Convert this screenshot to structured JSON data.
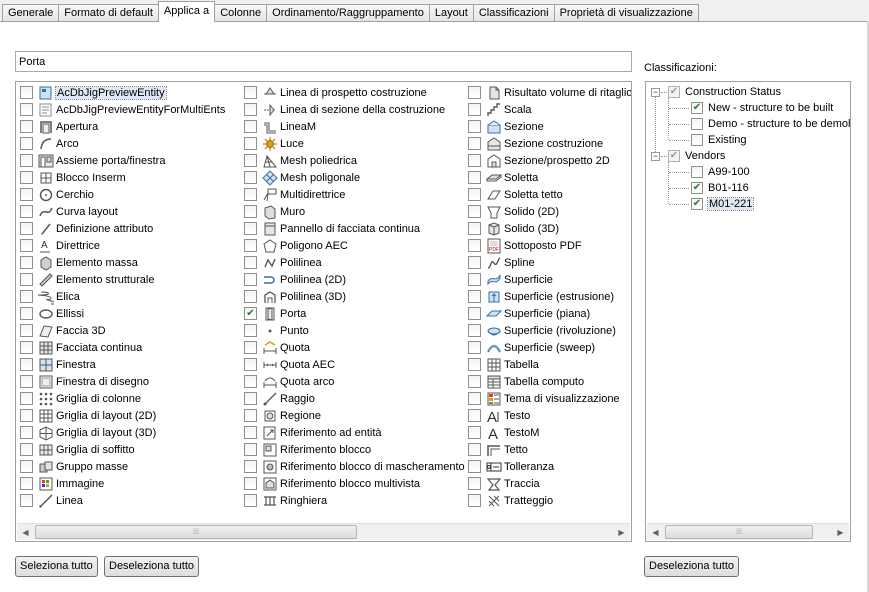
{
  "tabs": [
    {
      "label": "Generale",
      "active": false
    },
    {
      "label": "Formato di default",
      "active": false
    },
    {
      "label": "Applica a",
      "active": true
    },
    {
      "label": "Colonne",
      "active": false
    },
    {
      "label": "Ordinamento/Raggruppamento",
      "active": false
    },
    {
      "label": "Layout",
      "active": false
    },
    {
      "label": "Classificazioni",
      "active": false
    },
    {
      "label": "Proprietà di visualizzazione",
      "active": false
    }
  ],
  "filter": {
    "value": "Porta"
  },
  "objects": {
    "columns": [
      [
        {
          "label": "AcDbJigPreviewEntity",
          "icon": "jig-preview-icon",
          "checked": false,
          "selected": true
        },
        {
          "label": "AcDbJigPreviewEntityForMultiEnts",
          "icon": "jig-preview-multi-icon",
          "checked": false
        },
        {
          "label": "Apertura",
          "icon": "opening-icon",
          "checked": false
        },
        {
          "label": "Arco",
          "icon": "arc-icon",
          "checked": false
        },
        {
          "label": "Assieme porta/finestra",
          "icon": "door-window-assembly-icon",
          "checked": false
        },
        {
          "label": "Blocco Inserm",
          "icon": "block-insert-icon",
          "checked": false
        },
        {
          "label": "Cerchio",
          "icon": "circle-icon",
          "checked": false
        },
        {
          "label": "Curva layout",
          "icon": "layout-curve-icon",
          "checked": false
        },
        {
          "label": "Definizione attributo",
          "icon": "attribute-definition-icon",
          "checked": false
        },
        {
          "label": "Direttrice",
          "icon": "leader-icon",
          "checked": false
        },
        {
          "label": "Elemento massa",
          "icon": "mass-element-icon",
          "checked": false
        },
        {
          "label": "Elemento strutturale",
          "icon": "structural-member-icon",
          "checked": false
        },
        {
          "label": "Elica",
          "icon": "helix-icon",
          "checked": false
        },
        {
          "label": "Ellissi",
          "icon": "ellipse-icon",
          "checked": false
        },
        {
          "label": "Faccia 3D",
          "icon": "face-3d-icon",
          "checked": false
        },
        {
          "label": "Facciata continua",
          "icon": "curtain-wall-icon",
          "checked": false
        },
        {
          "label": "Finestra",
          "icon": "window-icon",
          "checked": false
        },
        {
          "label": "Finestra di disegno",
          "icon": "viewport-icon",
          "checked": false
        },
        {
          "label": "Griglia di colonne",
          "icon": "column-grid-icon",
          "checked": false
        },
        {
          "label": "Griglia di layout (2D)",
          "icon": "layout-grid-2d-icon",
          "checked": false
        },
        {
          "label": "Griglia di layout (3D)",
          "icon": "layout-grid-3d-icon",
          "checked": false
        },
        {
          "label": "Griglia di soffitto",
          "icon": "ceiling-grid-icon",
          "checked": false
        },
        {
          "label": "Gruppo masse",
          "icon": "mass-group-icon",
          "checked": false
        },
        {
          "label": "Immagine",
          "icon": "image-icon",
          "checked": false
        },
        {
          "label": "Linea",
          "icon": "line-icon",
          "checked": false
        }
      ],
      [
        {
          "label": "Linea di prospetto costruzione",
          "icon": "elevation-line-icon",
          "checked": false
        },
        {
          "label": "Linea di sezione della costruzione",
          "icon": "section-line-icon",
          "checked": false
        },
        {
          "label": "LineaM",
          "icon": "mline-icon",
          "checked": false
        },
        {
          "label": "Luce",
          "icon": "light-icon",
          "checked": false
        },
        {
          "label": "Mesh poliedrica",
          "icon": "polyface-mesh-icon",
          "checked": false
        },
        {
          "label": "Mesh poligonale",
          "icon": "polygon-mesh-icon",
          "checked": false
        },
        {
          "label": "Multidirettrice",
          "icon": "multileader-icon",
          "checked": false
        },
        {
          "label": "Muro",
          "icon": "wall-icon",
          "checked": false
        },
        {
          "label": "Pannello di facciata continua",
          "icon": "curtain-panel-icon",
          "checked": false
        },
        {
          "label": "Poligono AEC",
          "icon": "aec-polygon-icon",
          "checked": false
        },
        {
          "label": "Polilinea",
          "icon": "polyline-icon",
          "checked": false
        },
        {
          "label": "Polilinea (2D)",
          "icon": "polyline-2d-icon",
          "checked": false
        },
        {
          "label": "Polilinea (3D)",
          "icon": "polyline-3d-icon",
          "checked": false
        },
        {
          "label": "Porta",
          "icon": "door-icon",
          "checked": true
        },
        {
          "label": "Punto",
          "icon": "point-icon",
          "checked": false
        },
        {
          "label": "Quota",
          "icon": "dimension-icon",
          "checked": false
        },
        {
          "label": "Quota AEC",
          "icon": "aec-dimension-icon",
          "checked": false
        },
        {
          "label": "Quota arco",
          "icon": "arc-dimension-icon",
          "checked": false
        },
        {
          "label": "Raggio",
          "icon": "ray-icon",
          "checked": false
        },
        {
          "label": "Regione",
          "icon": "region-icon",
          "checked": false
        },
        {
          "label": "Riferimento ad entità",
          "icon": "entity-reference-icon",
          "checked": false
        },
        {
          "label": "Riferimento blocco",
          "icon": "block-reference-icon",
          "checked": false
        },
        {
          "label": "Riferimento blocco di mascheramento",
          "icon": "masking-block-icon",
          "checked": false
        },
        {
          "label": "Riferimento blocco multivista",
          "icon": "multiview-block-icon",
          "checked": false
        },
        {
          "label": "Ringhiera",
          "icon": "railing-icon",
          "checked": false
        }
      ],
      [
        {
          "label": "Risultato volume di ritaglio",
          "icon": "clip-volume-icon",
          "checked": false
        },
        {
          "label": "Scala",
          "icon": "stair-icon",
          "checked": false
        },
        {
          "label": "Sezione",
          "icon": "section-icon",
          "checked": false
        },
        {
          "label": "Sezione costruzione",
          "icon": "building-section-icon",
          "checked": false
        },
        {
          "label": "Sezione/prospetto 2D",
          "icon": "section-elevation-2d-icon",
          "checked": false
        },
        {
          "label": "Soletta",
          "icon": "slab-icon",
          "checked": false
        },
        {
          "label": "Soletta tetto",
          "icon": "roof-slab-icon",
          "checked": false
        },
        {
          "label": "Solido (2D)",
          "icon": "solid-2d-icon",
          "checked": false
        },
        {
          "label": "Solido (3D)",
          "icon": "solid-3d-icon",
          "checked": false
        },
        {
          "label": "Sottoposto PDF",
          "icon": "pdf-underlay-icon",
          "checked": false
        },
        {
          "label": "Spline",
          "icon": "spline-icon",
          "checked": false
        },
        {
          "label": "Superficie",
          "icon": "surface-icon",
          "checked": false
        },
        {
          "label": "Superficie (estrusione)",
          "icon": "extruded-surface-icon",
          "checked": false
        },
        {
          "label": "Superficie (piana)",
          "icon": "planar-surface-icon",
          "checked": false
        },
        {
          "label": "Superficie (rivoluzione)",
          "icon": "revolved-surface-icon",
          "checked": false
        },
        {
          "label": "Superficie (sweep)",
          "icon": "swept-surface-icon",
          "checked": false
        },
        {
          "label": "Tabella",
          "icon": "table-icon",
          "checked": false
        },
        {
          "label": "Tabella computo",
          "icon": "schedule-table-icon",
          "checked": false
        },
        {
          "label": "Tema di visualizzazione",
          "icon": "display-theme-icon",
          "checked": false
        },
        {
          "label": "Testo",
          "icon": "text-icon",
          "checked": false
        },
        {
          "label": "TestoM",
          "icon": "mtext-icon",
          "checked": false
        },
        {
          "label": "Tetto",
          "icon": "roof-icon",
          "checked": false
        },
        {
          "label": "Tolleranza",
          "icon": "tolerance-icon",
          "checked": false
        },
        {
          "label": "Traccia",
          "icon": "trace-icon",
          "checked": false
        },
        {
          "label": "Tratteggio",
          "icon": "hatch-icon",
          "checked": false
        }
      ]
    ]
  },
  "buttons": {
    "select_all": "Seleziona tutto",
    "deselect_all": "Deseleziona tutto",
    "class_deselect_all": "Deseleziona tutto"
  },
  "classifications": {
    "label": "Classificazioni:",
    "groups": [
      {
        "label": "Construction Status",
        "checked": true,
        "children": [
          {
            "label": "New - structure to be built",
            "checked": true
          },
          {
            "label": "Demo - structure to be demolis",
            "checked": false
          },
          {
            "label": "Existing",
            "checked": false
          }
        ]
      },
      {
        "label": "Vendors",
        "checked": true,
        "children": [
          {
            "label": "A99-100",
            "checked": false
          },
          {
            "label": "B01-116",
            "checked": true
          },
          {
            "label": "M01-221",
            "checked": true,
            "selected": true
          }
        ]
      }
    ]
  },
  "colors": {
    "check": "#2a7a2a",
    "icon_blue": "#3a6ea5",
    "icon_gold": "#d4a017",
    "selection": "#dfe8f5"
  }
}
